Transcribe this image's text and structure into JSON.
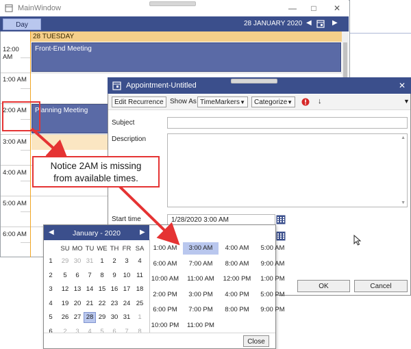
{
  "main_window": {
    "title": "MainWindow",
    "view_button": "Day",
    "current_date": "28 JANUARY 2020",
    "day_header": "28 TUESDAY",
    "time_slots": [
      "12:00 AM",
      "1:00 AM",
      "2:00 AM",
      "3:00 AM",
      "4:00 AM",
      "5:00 AM",
      "6:00 AM"
    ],
    "appointments": [
      {
        "title": "Front-End Meeting"
      },
      {
        "title": "Planning Meeting"
      }
    ]
  },
  "dialog": {
    "title": "Appointment-Untitled",
    "toolbar": {
      "edit_recurrence": "Edit Recurrence",
      "show_as_label": "Show As",
      "show_as_value": "TimeMarkers",
      "categorize": "Categorize"
    },
    "subject_label": "Subject",
    "description_label": "Description",
    "start_time_label": "Start time",
    "start_time_value": "1/28/2020 3:00 AM",
    "ok_label": "OK",
    "cancel_label": "Cancel"
  },
  "callout": {
    "line1": "Notice 2AM is missing",
    "line2": "from available times."
  },
  "picker": {
    "month_title": "January - 2020",
    "days_of_week": [
      "SU",
      "MO",
      "TU",
      "WE",
      "TH",
      "FR",
      "SA"
    ],
    "weeks": [
      {
        "num": "1",
        "days": [
          {
            "d": "29",
            "o": true
          },
          {
            "d": "30",
            "o": true
          },
          {
            "d": "31",
            "o": true
          },
          {
            "d": "1"
          },
          {
            "d": "2"
          },
          {
            "d": "3"
          },
          {
            "d": "4"
          }
        ]
      },
      {
        "num": "2",
        "days": [
          {
            "d": "5"
          },
          {
            "d": "6"
          },
          {
            "d": "7"
          },
          {
            "d": "8"
          },
          {
            "d": "9"
          },
          {
            "d": "10"
          },
          {
            "d": "11"
          }
        ]
      },
      {
        "num": "3",
        "days": [
          {
            "d": "12"
          },
          {
            "d": "13"
          },
          {
            "d": "14"
          },
          {
            "d": "15"
          },
          {
            "d": "16"
          },
          {
            "d": "17"
          },
          {
            "d": "18"
          }
        ]
      },
      {
        "num": "4",
        "days": [
          {
            "d": "19"
          },
          {
            "d": "20"
          },
          {
            "d": "21"
          },
          {
            "d": "22"
          },
          {
            "d": "23"
          },
          {
            "d": "24"
          },
          {
            "d": "25"
          }
        ]
      },
      {
        "num": "5",
        "days": [
          {
            "d": "26"
          },
          {
            "d": "27"
          },
          {
            "d": "28",
            "s": true
          },
          {
            "d": "29"
          },
          {
            "d": "30"
          },
          {
            "d": "31"
          },
          {
            "d": "1",
            "o": true
          }
        ]
      },
      {
        "num": "6",
        "days": [
          {
            "d": "2",
            "o": true
          },
          {
            "d": "3",
            "o": true
          },
          {
            "d": "4",
            "o": true
          },
          {
            "d": "5",
            "o": true
          },
          {
            "d": "6",
            "o": true
          },
          {
            "d": "7",
            "o": true
          },
          {
            "d": "8",
            "o": true
          }
        ]
      }
    ],
    "times": [
      [
        "1:00 AM",
        "3:00 AM",
        "4:00 AM",
        "5:00 AM"
      ],
      [
        "6:00 AM",
        "7:00 AM",
        "8:00 AM",
        "9:00 AM"
      ],
      [
        "10:00 AM",
        "11:00 AM",
        "12:00 PM",
        "1:00 PM"
      ],
      [
        "2:00 PM",
        "3:00 PM",
        "4:00 PM",
        "5:00 PM"
      ],
      [
        "6:00 PM",
        "7:00 PM",
        "8:00 PM",
        "9:00 PM"
      ],
      [
        "10:00 PM",
        "11:00 PM"
      ]
    ],
    "selected_time": "3:00 AM",
    "close_label": "Close"
  },
  "colors": {
    "accent": "#3b4f8c",
    "appointment": "#5a6aa6",
    "highlight": "#e53333",
    "day_header": "#f5cf8a",
    "selection": "#b9c7ee"
  }
}
